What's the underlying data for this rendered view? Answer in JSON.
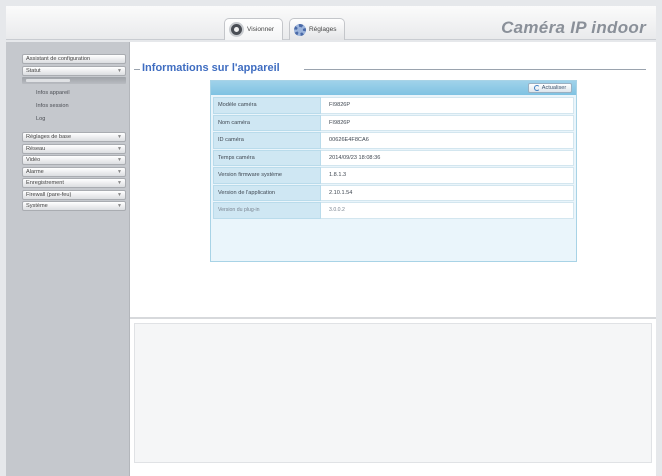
{
  "header": {
    "tabs": [
      {
        "label": "Visionner",
        "icon": "camera-icon",
        "active": true
      },
      {
        "label": "Réglages",
        "icon": "gear-icon",
        "active": false
      }
    ],
    "brand": "Caméra IP indoor"
  },
  "sidebar": {
    "items_top": [
      {
        "label": "Assistant de configuration"
      },
      {
        "label": "Statut"
      }
    ],
    "sub_links": [
      {
        "label": "Infos appareil"
      },
      {
        "label": "Infos session"
      },
      {
        "label": "Log"
      }
    ],
    "items_bottom": [
      {
        "label": "Réglages de base"
      },
      {
        "label": "Réseau"
      },
      {
        "label": "Vidéo"
      },
      {
        "label": "Alarme"
      },
      {
        "label": "Enregistrement"
      },
      {
        "label": "Firewall (pare-feu)"
      },
      {
        "label": "Système"
      }
    ]
  },
  "main": {
    "section_title": "Informations sur l'appareil",
    "refresh_label": "Actualiser",
    "info_rows": [
      {
        "label": "Modèle caméra",
        "value": "FI9826P"
      },
      {
        "label": "Nom caméra",
        "value": "FI9826P"
      },
      {
        "label": "ID caméra",
        "value": "00626E4F8CA6"
      },
      {
        "label": "Temps caméra",
        "value": "2014/09/23 18:08:36"
      },
      {
        "label": "Version firmware système",
        "value": "1.8.1.3"
      },
      {
        "label": "Version de l'application",
        "value": "2.10.1.54"
      },
      {
        "label": "Version du plug-in",
        "value": "3.0.0.2"
      }
    ]
  },
  "colors": {
    "accent_title": "#3f6dc1",
    "panel_header": "#7fc2e2",
    "label_cell": "#cfe7f3"
  }
}
